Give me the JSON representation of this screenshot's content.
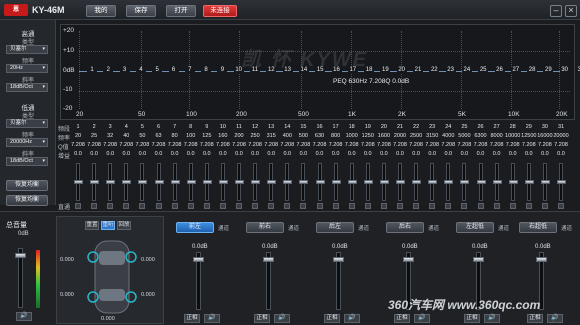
{
  "app": {
    "logo": "恩",
    "title": "KY-46M"
  },
  "toolbar": {
    "mine": "我的",
    "save": "保存",
    "open": "打开",
    "disconnected": "未连接",
    "minimize": "–",
    "close": "×"
  },
  "highpass": {
    "title": "高通",
    "type_label": "类型",
    "type_value": "贝塞尔",
    "freq_label": "频率",
    "freq_value": "20Hz",
    "slope_label": "斜率",
    "slope_value": "18dB/Oct"
  },
  "lowpass": {
    "title": "低通",
    "type_label": "类型",
    "type_value": "贝塞尔",
    "freq_label": "频率",
    "freq_value": "20000Hz",
    "slope_label": "斜率",
    "slope_value": "18dB/Oct"
  },
  "side_buttons": {
    "reset_eq": "恢复均衡",
    "reset_bypass": "恢复均衡"
  },
  "graph": {
    "y_labels": [
      "+20",
      "+10",
      "0dB",
      "-10",
      "-20"
    ],
    "x_labels": [
      "20",
      "50",
      "100",
      "200",
      "500",
      "1K",
      "2K",
      "5K",
      "10K",
      "20K"
    ],
    "peq_readout": "PEQ 630Hz 7.208Q 0.0dB",
    "watermark": "凯 怀 KYWE",
    "points": [
      "1",
      "2",
      "3",
      "4",
      "5",
      "6",
      "7",
      "8",
      "9",
      "10",
      "11",
      "12",
      "13",
      "14",
      "15",
      "16",
      "17",
      "18",
      "19",
      "20",
      "21",
      "22",
      "23",
      "24",
      "25",
      "26",
      "27",
      "28",
      "29",
      "30",
      "31"
    ]
  },
  "eq_table": {
    "row_labels": [
      "频段",
      "频率",
      "Q值",
      "增益"
    ],
    "bands": [
      "1",
      "2",
      "3",
      "4",
      "5",
      "6",
      "7",
      "8",
      "9",
      "10",
      "11",
      "12",
      "13",
      "14",
      "15",
      "16",
      "17",
      "18",
      "19",
      "20",
      "21",
      "22",
      "23",
      "24",
      "25",
      "26",
      "27",
      "28",
      "29",
      "30",
      "31"
    ],
    "freqs": [
      "20",
      "25",
      "32",
      "40",
      "50",
      "63",
      "80",
      "100",
      "125",
      "160",
      "200",
      "250",
      "315",
      "400",
      "500",
      "630",
      "800",
      "1000",
      "1250",
      "1600",
      "2000",
      "2500",
      "3150",
      "4000",
      "5000",
      "6300",
      "8000",
      "10000",
      "12500",
      "16000",
      "20000"
    ],
    "q": "7.208",
    "gain": "0.0",
    "bypass_label": "直通"
  },
  "master": {
    "title": "总音量",
    "value": "0dB",
    "mute_icon": "speaker-icon"
  },
  "car": {
    "tabs": [
      "重置",
      "重听",
      "回放"
    ],
    "distance_values": [
      "0.000",
      "0.000",
      "0.000",
      "0.000",
      "0.000"
    ]
  },
  "channels": [
    {
      "name": "前左",
      "tag": "通道",
      "volume": "0.0dB",
      "phase": "正相",
      "active": true
    },
    {
      "name": "前右",
      "tag": "通道",
      "volume": "0.0dB",
      "phase": "正相",
      "active": false
    },
    {
      "name": "后左",
      "tag": "通道",
      "volume": "0.0dB",
      "phase": "正相",
      "active": false
    },
    {
      "name": "后右",
      "tag": "通道",
      "volume": "0.0dB",
      "phase": "正相",
      "active": false
    },
    {
      "name": "左超低",
      "tag": "通道",
      "volume": "0.0dB",
      "phase": "正相",
      "active": false
    },
    {
      "name": "右超低",
      "tag": "通道",
      "volume": "0.0dB",
      "phase": "正相",
      "active": false
    }
  ],
  "site_watermark": "360汽车网 www.360qc.com"
}
